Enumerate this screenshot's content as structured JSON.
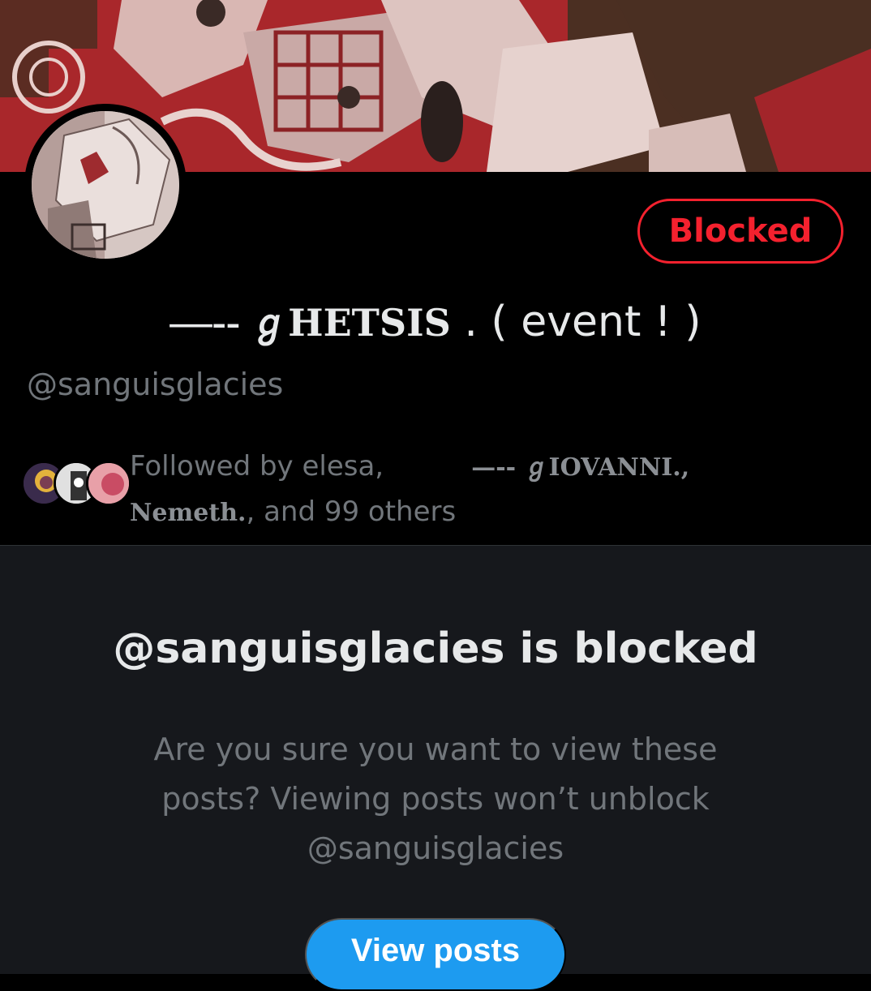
{
  "profile": {
    "blocked_label": "Blocked",
    "display_name_dash": "—-- ",
    "display_name_fancy": "ℊHETSIS",
    "display_name_rest": " . ( event ! )",
    "handle": "@sanguisglacies"
  },
  "followers": {
    "text_prefix": "Followed by elesa,",
    "name_2": "—-- ℊIOVANNI.,",
    "name_3": "Nemeth.",
    "text_suffix": ", and 99 others"
  },
  "blocked_notice": {
    "title": "@sanguisglacies is blocked",
    "message": "Are you sure you want to view these posts? Viewing posts won’t unblock @sanguisglacies",
    "button_label": "View posts"
  },
  "colors": {
    "accent": "#1d9bf0",
    "blocked_red": "#f4212e",
    "banner_red": "#b3282d"
  },
  "icons": [
    "banner-image",
    "profile-avatar",
    "follower-avatar"
  ]
}
